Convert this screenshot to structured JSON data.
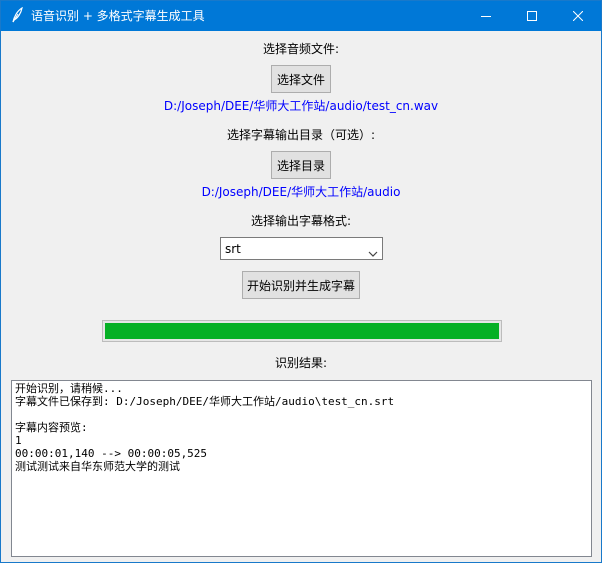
{
  "window": {
    "title": "语音识别 + 多格式字幕生成工具",
    "icon": "feather-icon",
    "controls": [
      "minimize-icon",
      "maximize-icon",
      "close-icon"
    ]
  },
  "audio": {
    "label": "选择音频文件:",
    "button": "选择文件",
    "path": "D:/Joseph/DEE/华师大工作站/audio/test_cn.wav"
  },
  "output_dir": {
    "label": "选择字幕输出目录（可选）:",
    "button": "选择目录",
    "path": "D:/Joseph/DEE/华师大工作站/audio"
  },
  "format": {
    "label": "选择输出字幕格式:",
    "selected": "srt"
  },
  "start_button": "开始识别并生成字幕",
  "progress": {
    "percent": 100,
    "color": "#06b025"
  },
  "result": {
    "label": "识别结果:",
    "lines": [
      "开始识别，请稍候...",
      "字幕文件已保存到: D:/Joseph/DEE/华师大工作站/audio\\test_cn.srt",
      "",
      "字幕内容预览:",
      "1",
      "00:00:01,140 --> 00:00:05,525",
      "测试测试来自华东师范大学的测试"
    ]
  },
  "colors": {
    "titlebar": "#0078d7",
    "path_text": "#0000ff"
  }
}
